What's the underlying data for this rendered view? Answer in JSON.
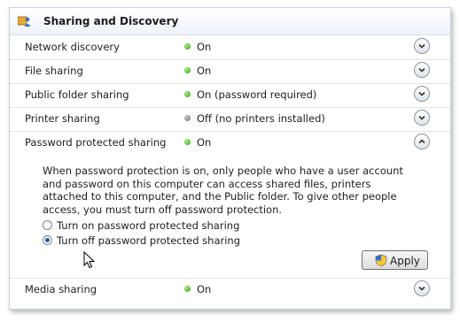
{
  "section": {
    "title": "Sharing and Discovery"
  },
  "rows": [
    {
      "label": "Network discovery",
      "status": "On",
      "state": "on",
      "expanded": false
    },
    {
      "label": "File sharing",
      "status": "On",
      "state": "on",
      "expanded": false
    },
    {
      "label": "Public folder sharing",
      "status": "On (password required)",
      "state": "on",
      "expanded": false
    },
    {
      "label": "Printer sharing",
      "status": "Off (no printers installed)",
      "state": "off",
      "expanded": false
    },
    {
      "label": "Password protected sharing",
      "status": "On",
      "state": "on",
      "expanded": true
    },
    {
      "label": "Media sharing",
      "status": "On",
      "state": "on",
      "expanded": false
    }
  ],
  "password_panel": {
    "description": "When password protection is on, only people who have a user account and password on this computer can access shared files, printers attached to this computer, and the Public folder. To give other people access, you must turn off password protection.",
    "options": [
      {
        "label": "Turn on password protected sharing",
        "selected": false
      },
      {
        "label": "Turn off password protected sharing",
        "selected": true
      }
    ],
    "apply_label": "Apply"
  },
  "icons": {
    "header": "sharing-center-icon",
    "status_on": "green-status-dot-icon",
    "status_off": "gray-status-dot-icon",
    "expand": "chevron-down-icon",
    "collapse": "chevron-up-icon",
    "apply": "uac-shield-icon"
  },
  "colors": {
    "status_on": "#2f9a1b",
    "status_off": "#6d6d6d",
    "radio_selected": "#1a5fb4"
  }
}
